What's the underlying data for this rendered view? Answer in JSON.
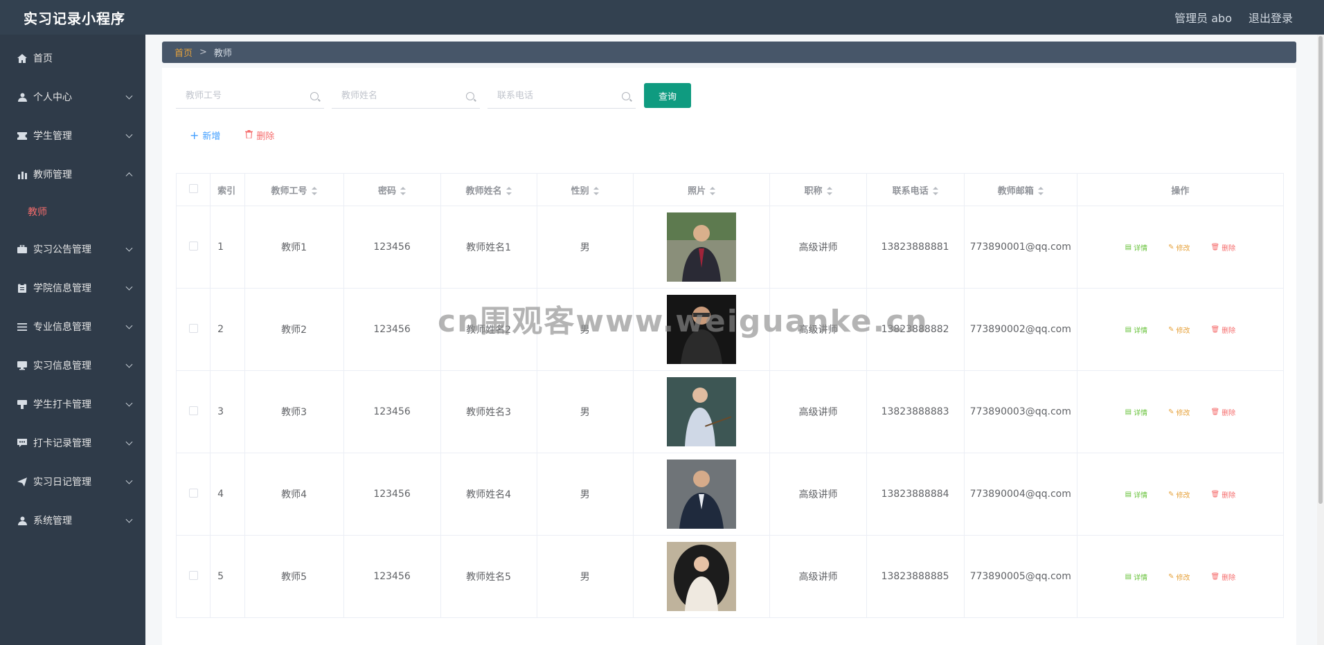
{
  "header": {
    "title": "实习记录小程序",
    "user": "管理员 abo",
    "logout": "退出登录"
  },
  "sidebar": {
    "items": [
      {
        "label": "首页",
        "icon": "home-icon",
        "chevron": "none"
      },
      {
        "label": "个人中心",
        "icon": "user-icon",
        "chevron": "down"
      },
      {
        "label": "学生管理",
        "icon": "ticket-icon",
        "chevron": "down"
      },
      {
        "label": "教师管理",
        "icon": "bar-chart-icon",
        "chevron": "up"
      },
      {
        "label": "实习公告管理",
        "icon": "briefcase-icon",
        "chevron": "down"
      },
      {
        "label": "学院信息管理",
        "icon": "clipboard-icon",
        "chevron": "down"
      },
      {
        "label": "专业信息管理",
        "icon": "list-icon",
        "chevron": "down"
      },
      {
        "label": "实习信息管理",
        "icon": "monitor-icon",
        "chevron": "down"
      },
      {
        "label": "学生打卡管理",
        "icon": "stamp-icon",
        "chevron": "down"
      },
      {
        "label": "打卡记录管理",
        "icon": "message-icon",
        "chevron": "down"
      },
      {
        "label": "实习日记管理",
        "icon": "send-icon",
        "chevron": "down"
      },
      {
        "label": "系统管理",
        "icon": "user-icon",
        "chevron": "down"
      }
    ],
    "submenu": {
      "label": "教师"
    }
  },
  "breadcrumb": {
    "home": "首页",
    "sep": ">",
    "current": "教师"
  },
  "search": {
    "fields": [
      {
        "placeholder": "教师工号"
      },
      {
        "placeholder": "教师姓名"
      },
      {
        "placeholder": "联系电话"
      }
    ],
    "button": "查询"
  },
  "toolbar": {
    "add": "新增",
    "delete": "删除"
  },
  "table": {
    "headers": [
      "索引",
      "教师工号",
      "密码",
      "教师姓名",
      "性别",
      "照片",
      "职称",
      "联系电话",
      "教师邮箱",
      "操作"
    ],
    "op_labels": {
      "detail": "详情",
      "edit": "修改",
      "remove": "删除"
    },
    "rows": [
      {
        "index": "1",
        "id": "教师1",
        "password": "123456",
        "name": "教师姓名1",
        "gender": "男",
        "title": "高级讲师",
        "phone": "13823888881",
        "email": "773890001@qq.com"
      },
      {
        "index": "2",
        "id": "教师2",
        "password": "123456",
        "name": "教师姓名2",
        "gender": "男",
        "title": "高级讲师",
        "phone": "13823888882",
        "email": "773890002@qq.com"
      },
      {
        "index": "3",
        "id": "教师3",
        "password": "123456",
        "name": "教师姓名3",
        "gender": "男",
        "title": "高级讲师",
        "phone": "13823888883",
        "email": "773890003@qq.com"
      },
      {
        "index": "4",
        "id": "教师4",
        "password": "123456",
        "name": "教师姓名4",
        "gender": "男",
        "title": "高级讲师",
        "phone": "13823888884",
        "email": "773890004@qq.com"
      },
      {
        "index": "5",
        "id": "教师5",
        "password": "123456",
        "name": "教师姓名5",
        "gender": "男",
        "title": "高级讲师",
        "phone": "13823888885",
        "email": "773890005@qq.com"
      }
    ]
  },
  "watermark": "cn围观客www.weiguanke.cn",
  "colors": {
    "accent": "#0f9b80",
    "sidebar": "#2f3b49",
    "topbar": "#334150",
    "active": "#f56c6c"
  }
}
